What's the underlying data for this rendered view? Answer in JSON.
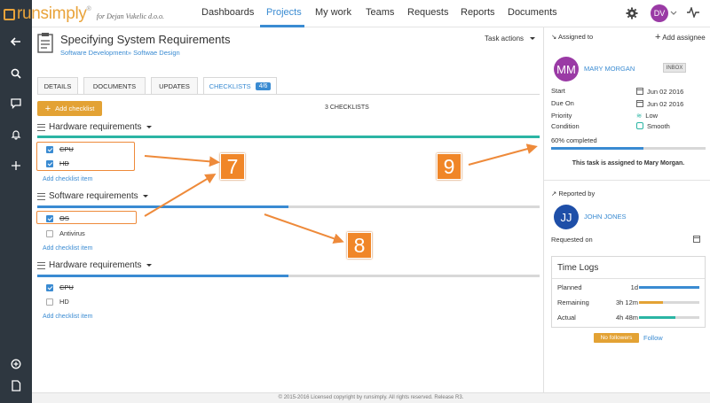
{
  "brand": {
    "name": "runsimply",
    "reg": "®",
    "tagline": "for Dejan Vukelic d.o.o."
  },
  "nav": [
    "Dashboards",
    "Projects",
    "My work",
    "Teams",
    "Requests",
    "Reports",
    "Documents"
  ],
  "nav_active": "Projects",
  "user_initials": "DV",
  "task": {
    "title": "Specifying System Requirements",
    "breadcrumb": "Software Development» Softwae Design",
    "actions_label": "Task actions"
  },
  "tabs": [
    {
      "label": "DETAILS"
    },
    {
      "label": "DOCUMENTS"
    },
    {
      "label": "UPDATES"
    },
    {
      "label": "CHECKLISTS",
      "badge": "4/6"
    }
  ],
  "add_checklist_label": "Add checklist",
  "checklists_count": "3 CHECKLISTS",
  "add_item_label": "Add checklist item",
  "checklists": [
    {
      "title": "Hardware requirements",
      "progress": 1.0,
      "color": "#2bb5a4",
      "items": [
        {
          "label": "CPU",
          "checked": true
        },
        {
          "label": "HD",
          "checked": true
        }
      ]
    },
    {
      "title": "Software requirements",
      "progress": 0.5,
      "color": "#3a8bd2",
      "items": [
        {
          "label": "OS",
          "checked": true
        },
        {
          "label": "Antivirus",
          "checked": false
        }
      ]
    },
    {
      "title": "Hardware requirements",
      "progress": 0.5,
      "color": "#3a8bd2",
      "items": [
        {
          "label": "CPU",
          "checked": true
        },
        {
          "label": "HD",
          "checked": false
        }
      ]
    }
  ],
  "markers": [
    "7",
    "8",
    "9"
  ],
  "panel": {
    "assigned_to_label": "Assigned to",
    "add_assignee_label": "Add assignee",
    "assignee": {
      "initials": "MM",
      "name": "MARY MORGAN",
      "badge": "INBOX"
    },
    "fields": [
      {
        "label": "Start",
        "value": "Jun 02 2016"
      },
      {
        "label": "Due On",
        "value": "Jun 02 2016"
      },
      {
        "label": "Priority",
        "value": "Low"
      },
      {
        "label": "Condition",
        "value": "Smooth"
      }
    ],
    "completed_label": "60% completed",
    "completed": 0.6,
    "assigned_msg": "This task is assigned to Mary Morgan.",
    "reported_by_label": "Reported by",
    "reporter": {
      "initials": "JJ",
      "name": "JOHN JONES"
    },
    "requested_on_label": "Requested on",
    "timelogs": {
      "title": "Time Logs",
      "rows": [
        {
          "label": "Planned",
          "value": "1d",
          "fill": 1.0,
          "color": "#3a8bd2"
        },
        {
          "label": "Remaining",
          "value": "3h 12m",
          "fill": 0.4,
          "color": "#e3a234"
        },
        {
          "label": "Actual",
          "value": "4h 48m",
          "fill": 0.6,
          "color": "#2bb5a4"
        }
      ]
    },
    "no_followers_label": "No followers",
    "follow_label": "Follow"
  },
  "footer": "© 2015-2016 Licensed copyright by runsimply. All rights reserved. Release R3."
}
